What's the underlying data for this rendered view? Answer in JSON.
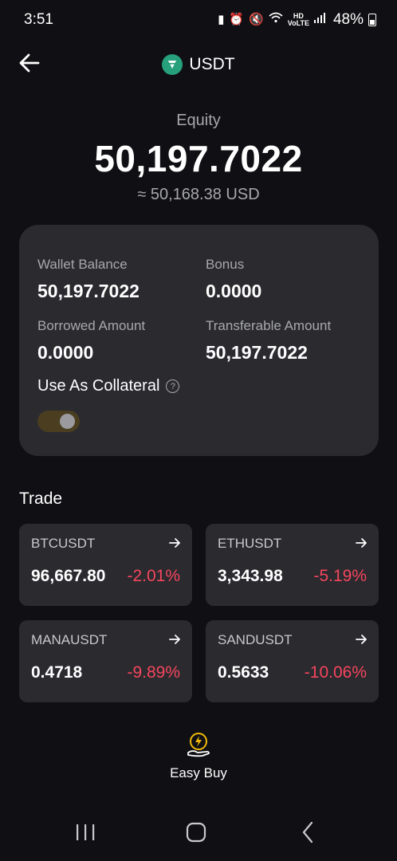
{
  "status_bar": {
    "time": "3:51",
    "battery": "48%",
    "icons": [
      "battery-saver-icon",
      "alarm-icon",
      "mute-icon",
      "wifi-icon",
      "hd-voice-icon",
      "signal-icon",
      "battery-icon"
    ]
  },
  "header": {
    "title": "USDT",
    "back_icon": "arrow-left-icon",
    "coin_icon": "tether-icon"
  },
  "equity": {
    "label": "Equity",
    "value": "50,197.7022",
    "usd": "≈ 50,168.38 USD"
  },
  "balance_card": {
    "wallet_balance_label": "Wallet Balance",
    "wallet_balance_value": "50,197.7022",
    "bonus_label": "Bonus",
    "bonus_value": "0.0000",
    "borrowed_label": "Borrowed Amount",
    "borrowed_value": "0.0000",
    "transferable_label": "Transferable Amount",
    "transferable_value": "50,197.7022",
    "collateral_label": "Use As Collateral",
    "collateral_enabled": true
  },
  "trade": {
    "title": "Trade",
    "pairs": [
      {
        "name": "BTCUSDT",
        "price": "96,667.80",
        "change": "-2.01%"
      },
      {
        "name": "ETHUSDT",
        "price": "3,343.98",
        "change": "-5.19%"
      },
      {
        "name": "MANAUSDT",
        "price": "0.4718",
        "change": "-9.89%"
      },
      {
        "name": "SANDUSDT",
        "price": "0.5633",
        "change": "-10.06%"
      }
    ]
  },
  "easy_buy": {
    "label": "Easy Buy",
    "icon": "lightning-hand-icon"
  },
  "nav": {
    "items": [
      "recent-apps-icon",
      "home-icon",
      "back-icon"
    ]
  },
  "colors": {
    "background": "#101014",
    "card": "#2a2a2f",
    "negative": "#f6465d",
    "accent": "#f0b90b",
    "tether": "#26a17b"
  }
}
